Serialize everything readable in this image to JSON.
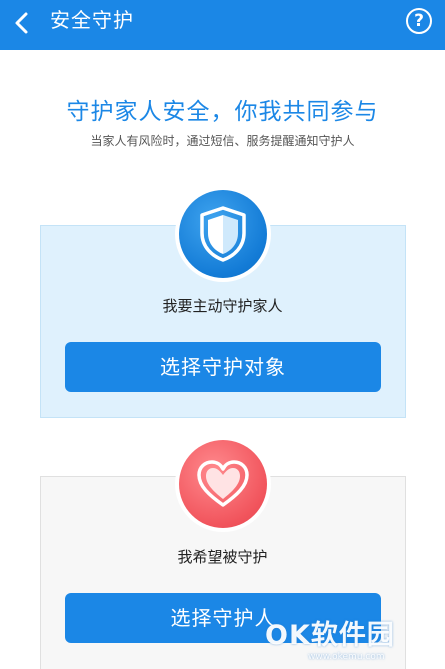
{
  "header": {
    "title": "安全守护",
    "help_label": "?"
  },
  "intro": {
    "headline": "守护家人安全，你我共同参与",
    "subline": "当家人有风险时，通过短信、服务提醒通知守护人"
  },
  "options": [
    {
      "icon": "shield-icon",
      "label": "我要主动守护家人",
      "button": "选择守护对象"
    },
    {
      "icon": "heart-icon",
      "label": "我希望被守护",
      "button": "选择守护人"
    }
  ],
  "watermark": {
    "logo": "OK软件园",
    "url": "www.okemu.com"
  },
  "colors": {
    "accent": "#1b87e6",
    "card_guard_bg": "#dff1fd",
    "card_guarded_bg": "#f7f7f7",
    "heart": "#f1545c"
  }
}
